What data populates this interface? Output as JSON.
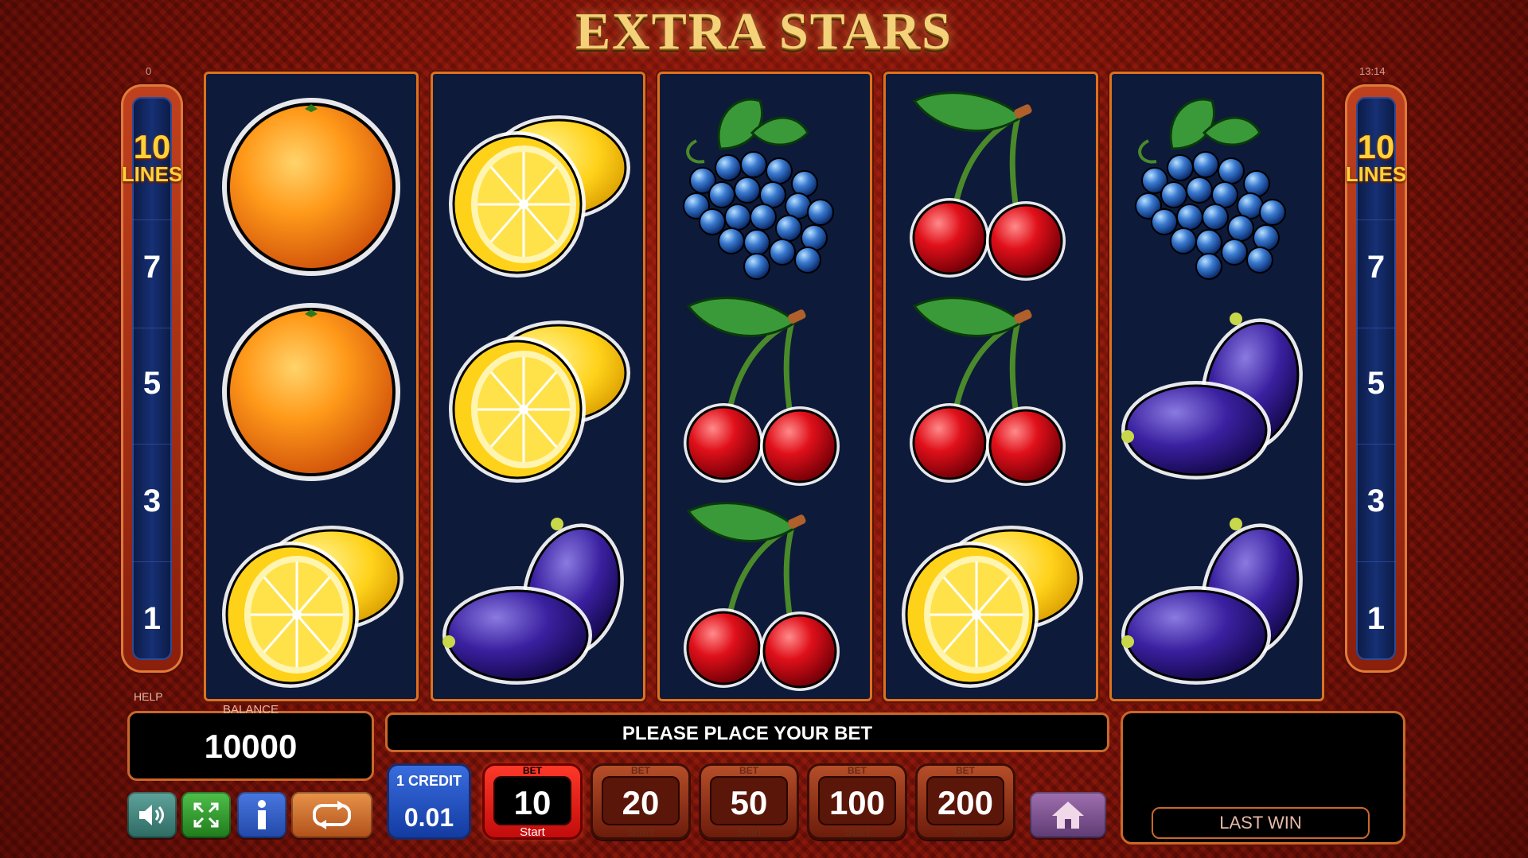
{
  "game": {
    "title": "EXTRA STARS"
  },
  "top": {
    "left_counter": "0",
    "clock": "13:14"
  },
  "lines": {
    "count": "10",
    "label": "LINES",
    "numbers": [
      "7",
      "5",
      "3",
      "1"
    ]
  },
  "reels": [
    [
      "orange",
      "orange",
      "lemon"
    ],
    [
      "lemon",
      "lemon",
      "plum"
    ],
    [
      "grapes",
      "cherry",
      "cherry"
    ],
    [
      "cherry",
      "cherry",
      "lemon"
    ],
    [
      "grapes",
      "plum",
      "plum"
    ]
  ],
  "panel": {
    "help_label": "HELP",
    "balance_label": "BALANCE",
    "balance_value": "10000",
    "message": "PLEASE PLACE YOUR BET",
    "last_win_label": "LAST WIN",
    "credit_label": "1 CREDIT",
    "credit_value": "0.01",
    "bet_caption": "BET",
    "start_label": "Start",
    "bets": [
      "10",
      "20",
      "50",
      "100",
      "200"
    ],
    "active_bet": "10"
  },
  "icons": [
    "speaker-icon",
    "fullscreen-icon",
    "info-icon",
    "autoplay-icon",
    "home-icon"
  ],
  "colors": {
    "accent": "#e0701e",
    "reel_bg": "#0e1a3a",
    "active_bet": "#e01a10",
    "credit_blue": "#2a56c8"
  }
}
